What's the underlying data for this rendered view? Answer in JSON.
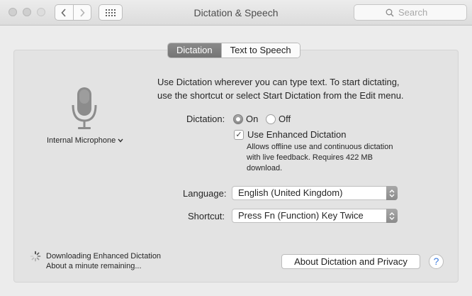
{
  "window": {
    "title": "Dictation & Speech",
    "search_placeholder": "Search"
  },
  "tabs": [
    {
      "label": "Dictation",
      "active": true
    },
    {
      "label": "Text to Speech",
      "active": false
    }
  ],
  "microphone": {
    "label": "Internal Microphone"
  },
  "description": [
    "Use Dictation wherever you can type text. To start dictating,",
    "use the shortcut or select Start Dictation from the Edit menu."
  ],
  "dictation": {
    "label": "Dictation:",
    "on_label": "On",
    "off_label": "Off",
    "selected": "On"
  },
  "enhanced": {
    "label": "Use Enhanced Dictation",
    "checked": true,
    "note": [
      "Allows offline use and continuous dictation",
      "with live feedback. Requires 422 MB",
      "download."
    ]
  },
  "language": {
    "label": "Language:",
    "value": "English (United Kingdom)"
  },
  "shortcut": {
    "label": "Shortcut:",
    "value": "Press Fn (Function) Key Twice"
  },
  "status": {
    "line1": "Downloading Enhanced Dictation",
    "line2": "About a minute remaining..."
  },
  "buttons": {
    "about": "About Dictation and Privacy",
    "help": "?"
  },
  "icons": {
    "close": "close-icon",
    "minimize": "minimize-icon",
    "zoom": "zoom-icon",
    "back": "chevron-left-icon",
    "forward": "chevron-right-icon",
    "show_all": "grid-icon",
    "search": "search-icon",
    "microphone": "microphone-icon",
    "spinner": "spinner-icon"
  }
}
